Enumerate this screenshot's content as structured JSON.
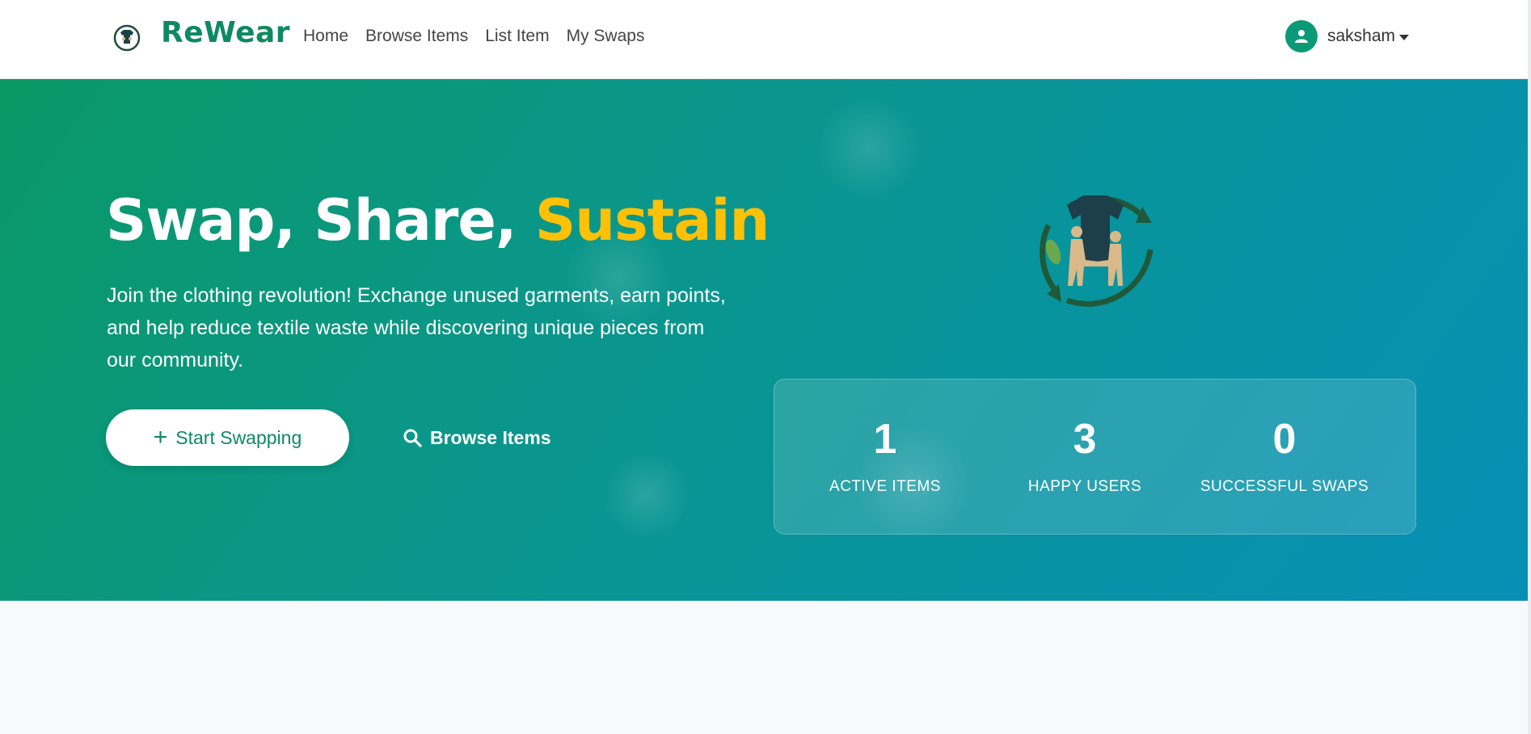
{
  "navbar": {
    "brand": "ReWear",
    "links": [
      "Home",
      "Browse Items",
      "List Item",
      "My Swaps"
    ],
    "user": {
      "name": "saksham"
    }
  },
  "hero": {
    "title_main": "Swap, Share, ",
    "title_accent": "Sustain",
    "description": "Join the clothing revolution! Exchange unused garments, earn points, and help reduce textile waste while discovering unique pieces from our community.",
    "primary_button": "Start Swapping",
    "secondary_button": "Browse Items"
  },
  "stats": [
    {
      "value": "1",
      "label": "ACTIVE ITEMS"
    },
    {
      "value": "3",
      "label": "HAPPY USERS"
    },
    {
      "value": "0",
      "label": "SUCCESSFUL SWAPS"
    }
  ],
  "colors": {
    "brand": "#0e8a5f",
    "accent": "#ffc107",
    "hero_gradient_start": "#0a9866",
    "hero_gradient_end": "#0790b6"
  }
}
